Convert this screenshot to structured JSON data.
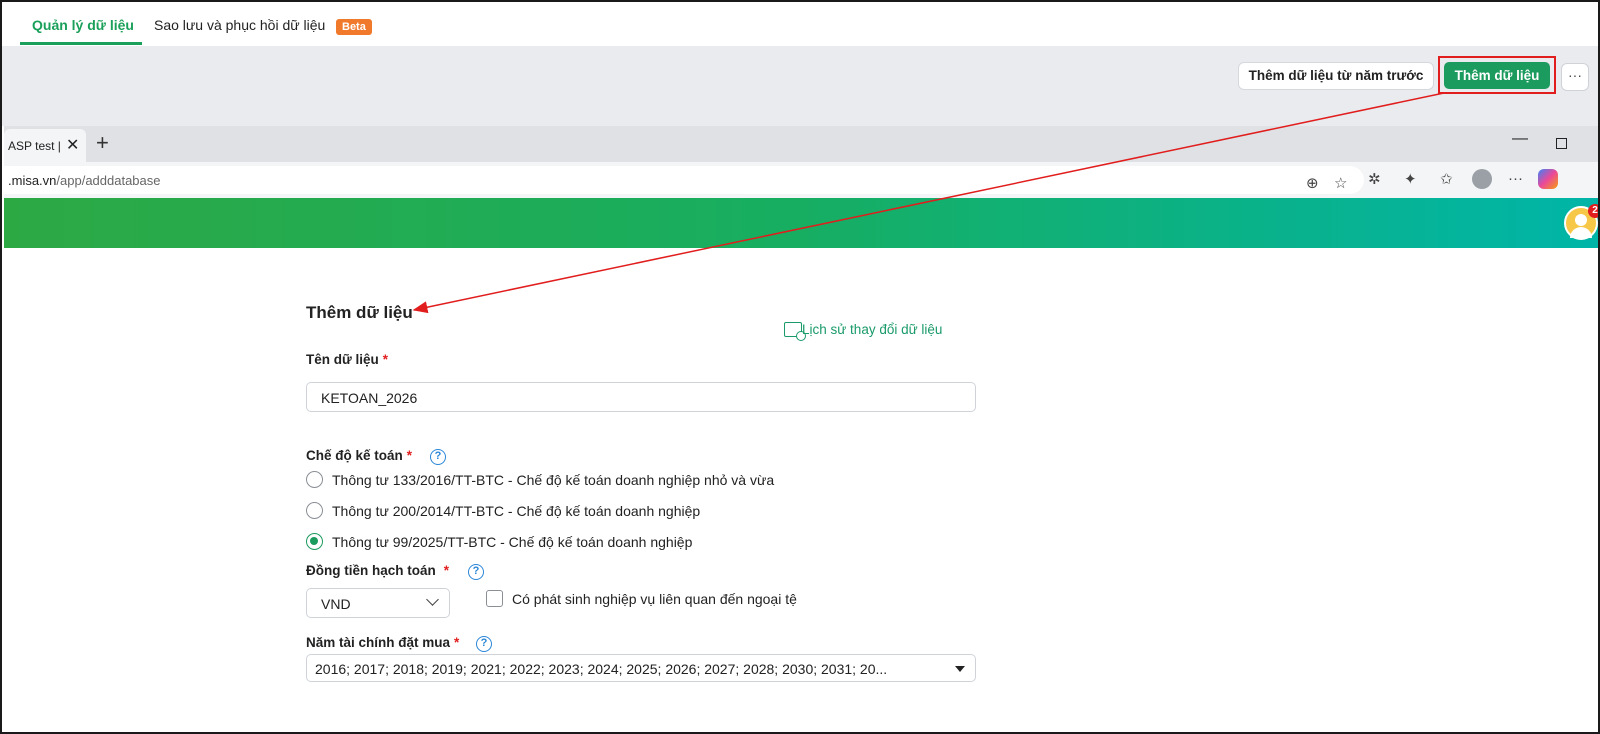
{
  "app": {
    "tabs": [
      {
        "label": "Quản lý dữ liệu",
        "active": true
      },
      {
        "label": "Sao lưu và phục hồi dữ liệu",
        "badge": "Beta"
      }
    ],
    "toolbar": {
      "prev_year_label": "Thêm dữ liệu từ năm trước",
      "add_label": "Thêm dữ liệu",
      "more_label": "···"
    }
  },
  "browser": {
    "tab_title": "ASP test | M",
    "url_host": ".misa.vn",
    "url_path": "/app/adddatabase",
    "notifications": "2"
  },
  "form": {
    "title": "Thêm dữ liệu",
    "history_link": "Lịch sử thay đổi dữ liệu",
    "name_label": "Tên dữ liệu",
    "name_value": "KETOAN_2026",
    "regime_label": "Chế độ kế toán",
    "regime_options": [
      {
        "label": "Thông tư 133/2016/TT-BTC - Chế độ kế toán doanh nghiệp nhỏ và vừa",
        "checked": false
      },
      {
        "label": "Thông tư 200/2014/TT-BTC - Chế độ kế toán doanh nghiệp",
        "checked": false
      },
      {
        "label": "Thông tư 99/2025/TT-BTC - Chế độ kế toán doanh nghiệp",
        "checked": true
      }
    ],
    "currency_label": "Đồng tiền hạch toán",
    "currency_value": "VND",
    "foreign_currency_label": "Có phát sinh nghiệp vụ liên quan đến ngoại tệ",
    "foreign_currency_checked": false,
    "fiscal_year_label": "Năm tài chính đặt mua",
    "fiscal_years_value": "2016; 2017; 2018; 2019; 2021; 2022; 2023; 2024; 2025; 2026; 2027; 2028; 2030; 2031; 20...",
    "required_mark": "*",
    "help_mark": "?"
  },
  "colors": {
    "brand_green": "#1c9b5e",
    "highlight_red": "#e11d1d",
    "beta_orange": "#f0792c",
    "link_blue": "#2b87d8"
  }
}
